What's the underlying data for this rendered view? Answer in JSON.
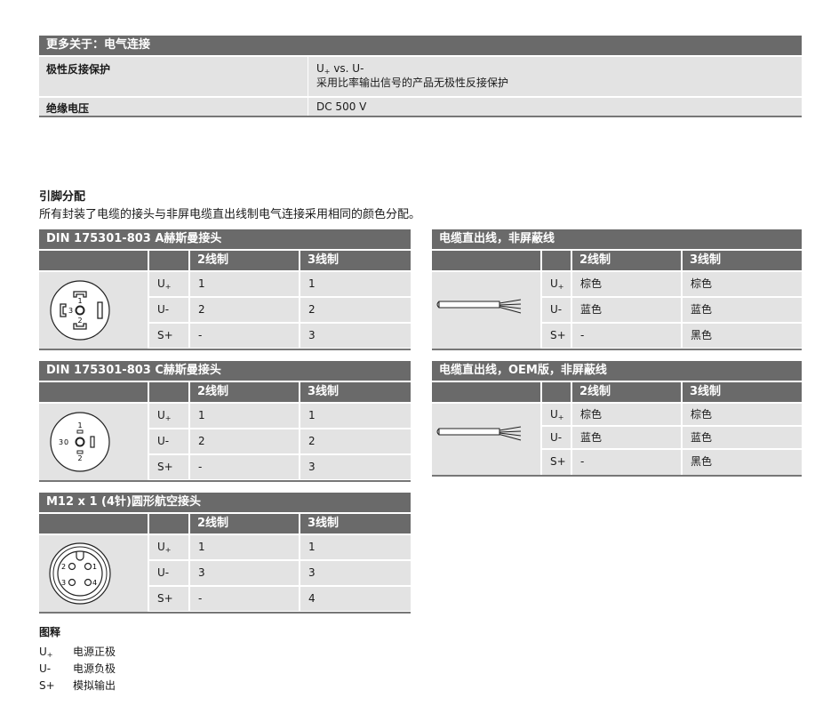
{
  "more_about": {
    "header": "更多关于：电气连接",
    "rows": [
      {
        "label": "极性反接保护",
        "value_line1": "U+ vs. U-",
        "value_line2": "采用比率输出信号的产品无极性反接保护"
      },
      {
        "label": "绝缘电压",
        "value_line1": "DC 500 V"
      }
    ]
  },
  "pin_assignment": {
    "title": "引脚分配",
    "description": "所有封装了电缆的接头与非屏电缆直出线制电气连接采用相同的颜色分配。"
  },
  "col_2wire": "2线制",
  "col_3wire": "3线制",
  "tables": {
    "din_a": {
      "header": "DIN 175301-803 A赫斯曼接头",
      "rows": [
        {
          "sig": "U+",
          "w2": "1",
          "w3": "1"
        },
        {
          "sig": "U-",
          "w2": "2",
          "w3": "2"
        },
        {
          "sig": "S+",
          "w2": "-",
          "w3": "3"
        }
      ]
    },
    "din_c": {
      "header": "DIN 175301-803 C赫斯曼接头",
      "rows": [
        {
          "sig": "U+",
          "w2": "1",
          "w3": "1"
        },
        {
          "sig": "U-",
          "w2": "2",
          "w3": "2"
        },
        {
          "sig": "S+",
          "w2": "-",
          "w3": "3"
        }
      ]
    },
    "m12": {
      "header": "M12 x 1 (4针)圆形航空接头",
      "rows": [
        {
          "sig": "U+",
          "w2": "1",
          "w3": "1"
        },
        {
          "sig": "U-",
          "w2": "3",
          "w3": "3"
        },
        {
          "sig": "S+",
          "w2": "-",
          "w3": "4"
        }
      ]
    },
    "cable": {
      "header": "电缆直出线，非屏蔽线",
      "rows": [
        {
          "sig": "U+",
          "w2": "棕色",
          "w3": "棕色"
        },
        {
          "sig": "U-",
          "w2": "蓝色",
          "w3": "蓝色"
        },
        {
          "sig": "S+",
          "w2": "-",
          "w3": "黑色"
        }
      ]
    },
    "cable_oem": {
      "header": "电缆直出线，OEM版，非屏蔽线",
      "rows": [
        {
          "sig": "U+",
          "w2": "棕色",
          "w3": "棕色"
        },
        {
          "sig": "U-",
          "w2": "蓝色",
          "w3": "蓝色"
        },
        {
          "sig": "S+",
          "w2": "-",
          "w3": "黑色"
        }
      ]
    }
  },
  "connector_labels": {
    "din_a": [
      "1",
      "3",
      "2"
    ],
    "din_c": [
      "1",
      "3",
      "2"
    ],
    "m12": [
      "2",
      "1",
      "3",
      "4"
    ]
  },
  "legend": {
    "title": "图释",
    "items": [
      {
        "key": "U+",
        "text": "电源正极"
      },
      {
        "key": "U-",
        "text": "电源负极"
      },
      {
        "key": "S+",
        "text": "模拟输出"
      }
    ]
  }
}
